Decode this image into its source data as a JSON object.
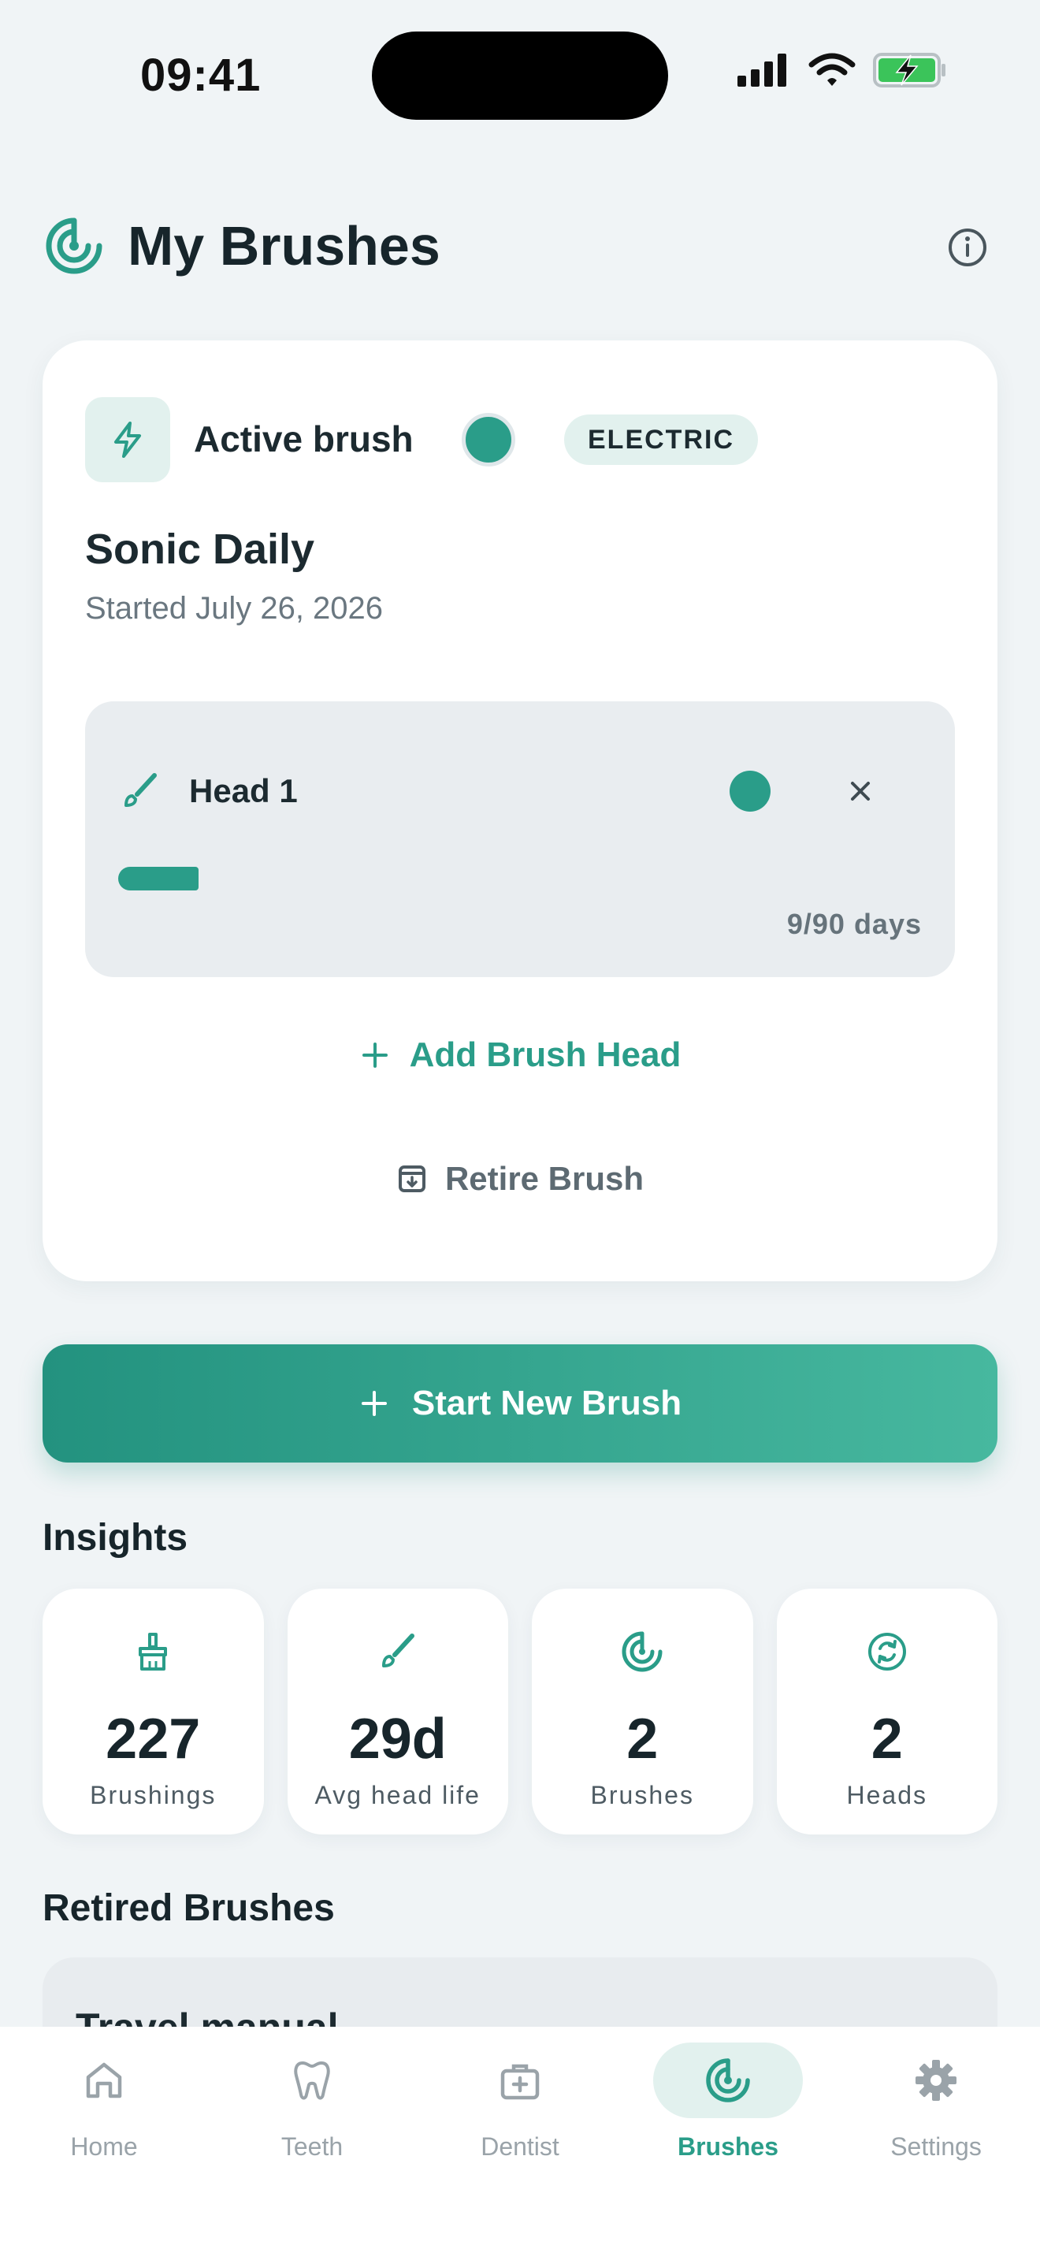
{
  "status_bar": {
    "time": "09:41"
  },
  "header": {
    "title": "My Brushes",
    "logo_icon": "brush-ring-icon",
    "info_icon": "info-icon"
  },
  "active_card": {
    "label": "Active brush",
    "color": "#2a9d89",
    "type_badge": "ELECTRIC",
    "brush_name": "Sonic Daily",
    "started": "Started July 26, 2026",
    "head": {
      "label": "Head 1",
      "color": "#2a9d89",
      "days_used": 9,
      "days_total": 90,
      "progress_fraction": 0.1,
      "days_text": "9/90 days"
    },
    "add_head_label": "Add Brush Head",
    "retire_label": "Retire Brush"
  },
  "start_button": {
    "label": "Start New Brush"
  },
  "insights": {
    "title": "Insights",
    "stats": [
      {
        "icon": "broom-icon",
        "value": "227",
        "label": "Brushings"
      },
      {
        "icon": "paintbrush-icon",
        "value": "29d",
        "label": "Avg head life"
      },
      {
        "icon": "brush-ring-icon",
        "value": "2",
        "label": "Brushes"
      },
      {
        "icon": "refresh-icon",
        "value": "2",
        "label": "Heads"
      }
    ]
  },
  "retired": {
    "title": "Retired Brushes",
    "items": [
      {
        "name": "Travel manual"
      }
    ]
  },
  "tab_bar": {
    "tabs": [
      {
        "label": "Home",
        "icon": "home-icon",
        "active": false
      },
      {
        "label": "Teeth",
        "icon": "tooth-icon",
        "active": false
      },
      {
        "label": "Dentist",
        "icon": "medical-kit-icon",
        "active": false
      },
      {
        "label": "Brushes",
        "icon": "brush-ring-icon",
        "active": true
      },
      {
        "label": "Settings",
        "icon": "gear-icon",
        "active": false
      }
    ]
  },
  "colors": {
    "accent": "#2a9d89",
    "accent_light": "#e2f1ee",
    "background": "#f0f4f6"
  }
}
